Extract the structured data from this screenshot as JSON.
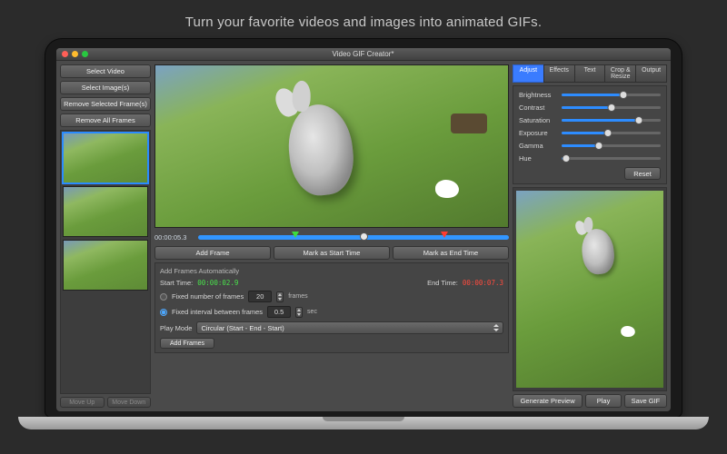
{
  "tagline": "Turn your favorite videos and images into animated GIFs.",
  "window": {
    "title": "Video GIF Creator*"
  },
  "left": {
    "select_video": "Select Video",
    "select_images": "Select Image(s)",
    "remove_selected": "Remove Selected Frame(s)",
    "remove_all": "Remove All Frames",
    "move_up": "Move Up",
    "move_down": "Move Down"
  },
  "timeline": {
    "timecode": "00:00:05.3",
    "add_frame": "Add Frame",
    "mark_start": "Mark as Start Time",
    "mark_end": "Mark as End Time"
  },
  "auto": {
    "title": "Add Frames Automatically",
    "start_label": "Start Time:",
    "start_value": "00:00:02.9",
    "end_label": "End Time:",
    "end_value": "00:00:07.3",
    "opt_fixed_count": "Fixed number of frames",
    "count_value": "20",
    "count_unit": "frames",
    "opt_fixed_interval": "Fixed interval between frames",
    "interval_value": "0.5",
    "interval_unit": "sec",
    "play_mode_label": "Play Mode",
    "play_mode_value": "Circular (Start - End - Start)",
    "add_frames": "Add Frames"
  },
  "tabs": {
    "adjust": "Adjust",
    "effects": "Effects",
    "text": "Text",
    "crop": "Crop & Resize",
    "output": "Output"
  },
  "adjust": {
    "brightness": {
      "label": "Brightness",
      "pct": 62
    },
    "contrast": {
      "label": "Contrast",
      "pct": 50
    },
    "saturation": {
      "label": "Saturation",
      "pct": 78
    },
    "exposure": {
      "label": "Exposure",
      "pct": 47
    },
    "gamma": {
      "label": "Gamma",
      "pct": 38
    },
    "hue": {
      "label": "Hue",
      "pct": 5
    },
    "reset": "Reset"
  },
  "right_buttons": {
    "generate": "Generate Preview",
    "play": "Play",
    "save": "Save GIF"
  }
}
